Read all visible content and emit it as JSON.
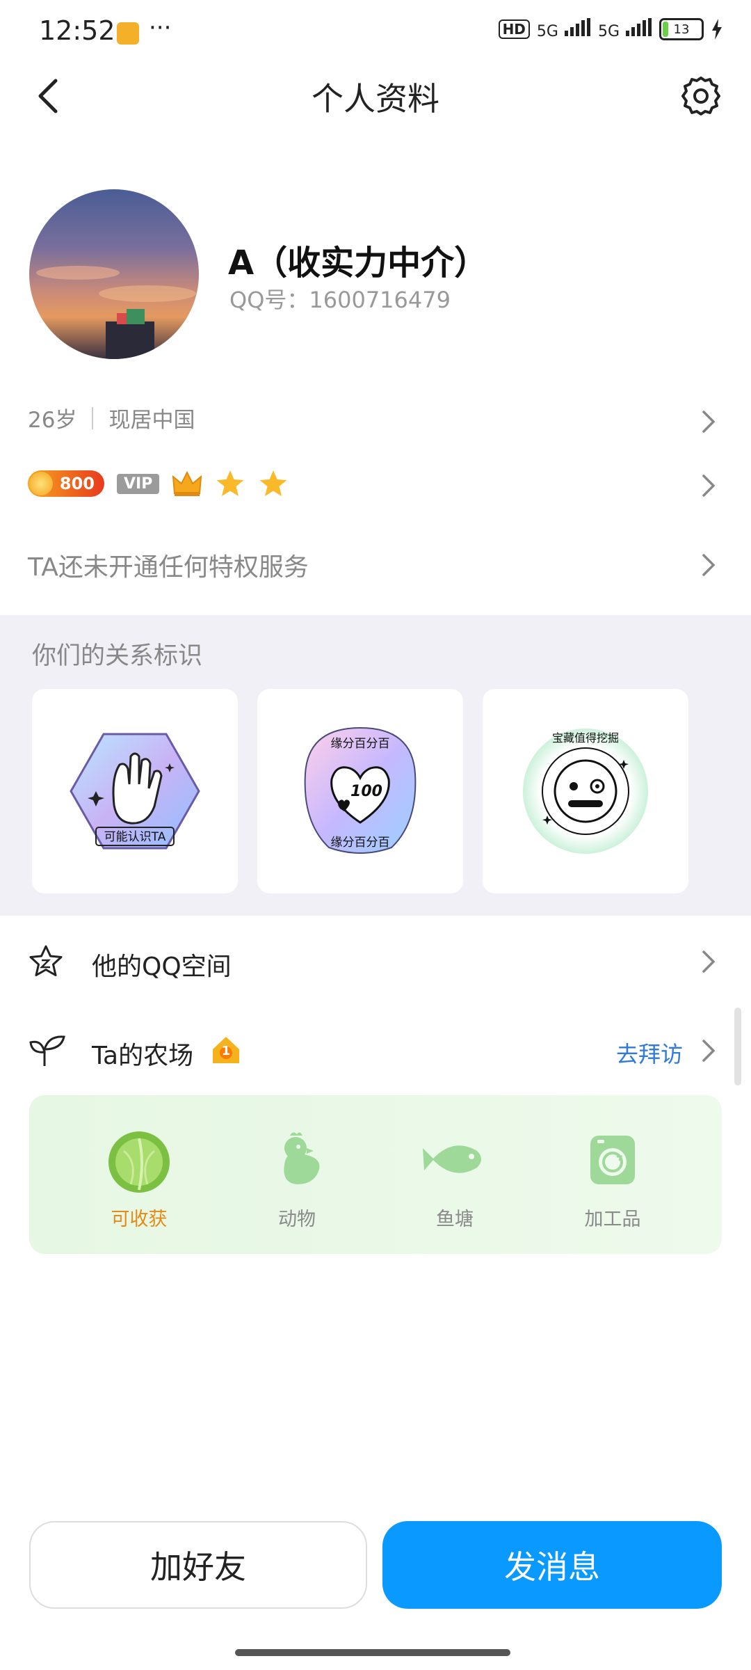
{
  "status_bar": {
    "time": "12:52",
    "more": "···",
    "hd": "HD",
    "net1": "5G",
    "net2": "5G",
    "battery": "13"
  },
  "nav": {
    "title": "个人资料",
    "back_icon": "chevron-left-icon",
    "settings_icon": "gear-icon"
  },
  "profile": {
    "nickname": "A（收实力中介）",
    "qq_label": "QQ号：1600716479",
    "age": "26岁",
    "location": "现居中国"
  },
  "badges": {
    "coin_value": "800",
    "vip_label": "VIP",
    "crown_icon": "crown-icon",
    "star_count": 2
  },
  "privilege": {
    "text": "TA还未开通任何特权服务"
  },
  "relationship": {
    "title": "你们的关系标识",
    "cards": [
      {
        "label": "可能认识TA",
        "icon": "wave-hand-icon"
      },
      {
        "top_text": "缘分百分百",
        "bottom_text": "缘分百分百",
        "badge": "100",
        "icon": "heart-icon"
      },
      {
        "ring_text": "宝藏值得挖掘",
        "icon": "face-icon"
      }
    ]
  },
  "list": {
    "qzone_label": "他的QQ空间",
    "farm_label": "Ta的农场",
    "farm_level": "1",
    "farm_visit": "去拜访"
  },
  "farm": {
    "items": [
      {
        "label": "可收获",
        "icon": "cabbage-icon",
        "active": true
      },
      {
        "label": "动物",
        "icon": "chicken-icon",
        "active": false
      },
      {
        "label": "鱼塘",
        "icon": "fish-icon",
        "active": false
      },
      {
        "label": "加工品",
        "icon": "processing-icon",
        "active": false
      }
    ]
  },
  "actions": {
    "add_friend": "加好友",
    "send_message": "发消息"
  },
  "colors": {
    "primary": "#0a99ff",
    "farm_active": "#e58a17",
    "link": "#2f7bd9"
  }
}
